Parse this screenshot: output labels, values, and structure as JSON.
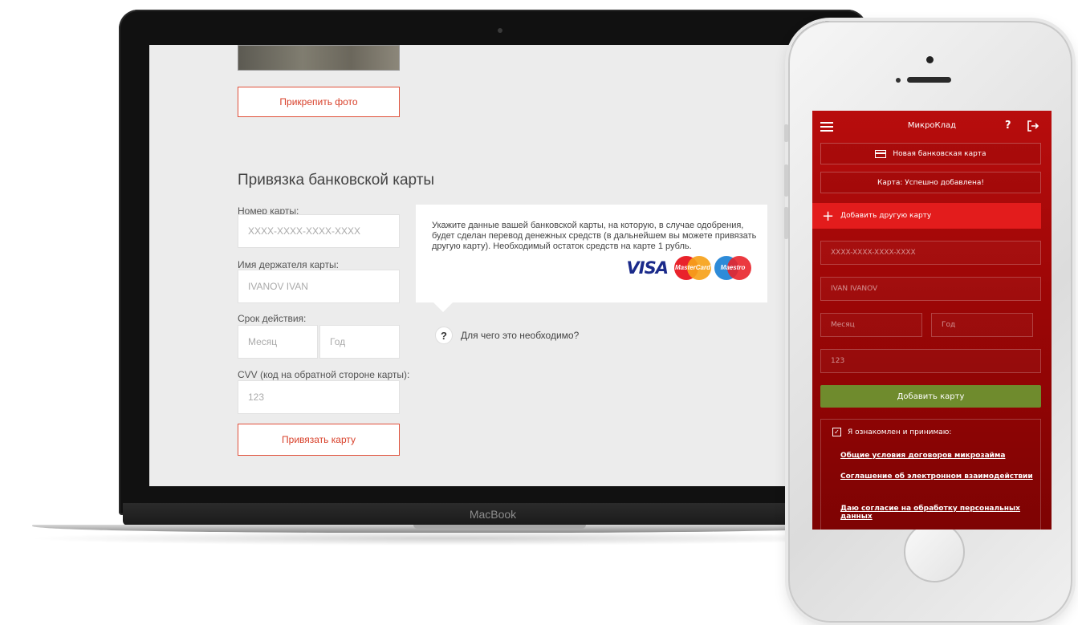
{
  "macbook": {
    "brand": "MacBook",
    "screen": {
      "attach_photo_label": "Прикрепить фото",
      "section_title": "Привязка банковской карты",
      "card_number_label": "Номер карты:",
      "card_number_placeholder": "XXXX-XXXX-XXXX-XXXX",
      "holder_label": "Имя держателя карты:",
      "holder_placeholder": "IVANOV IVAN",
      "expiry_label": "Срок действия:",
      "month_placeholder": "Месяц",
      "year_placeholder": "Год",
      "cvv_label": "CVV (код на обратной стороне карты):",
      "cvv_placeholder": "123",
      "bind_button_label": "Привязать карту",
      "info_text": "Укажите данные вашей банковской карты, на которую, в случае одобрения, будет сделан перевод денежных средств (в дальнейшем вы можете привязать другую карту). Необходимый остаток средств на карте 1 рубль.",
      "card_logos": [
        "VISA",
        "MasterCard",
        "Maestro"
      ],
      "help_icon_glyph": "?",
      "help_text": "Для чего это необходимо?"
    }
  },
  "phone": {
    "app_title": "МикроКлад",
    "help_glyph": "?",
    "new_card_label": "Новая банковская карта",
    "status_text": "Карта: Успешно добавлена!",
    "add_other_plus": "+",
    "add_other_label": "Добавить другую карту",
    "card_number_value": "XXXX-XXXX-XXXX-XXXX",
    "holder_value": "IVAN IVANOV",
    "month_placeholder": "Месяц",
    "year_placeholder": "Год",
    "cvv_value": "123",
    "add_card_button": "Добавить карту",
    "agree_label": "Я ознакомлен и принимаю:",
    "checkbox_glyph": "✓",
    "links": [
      "Общие условия договоров микрозайма",
      "Соглашение об электронном взаимодействии",
      "Даю согласие на обработку персональных данных"
    ],
    "colors": {
      "screen_red": "#b80d0d",
      "accent_red": "#e31c1c",
      "button_green": "#6f8b2d"
    }
  },
  "colors": {
    "mac_accent": "#e0503a"
  }
}
